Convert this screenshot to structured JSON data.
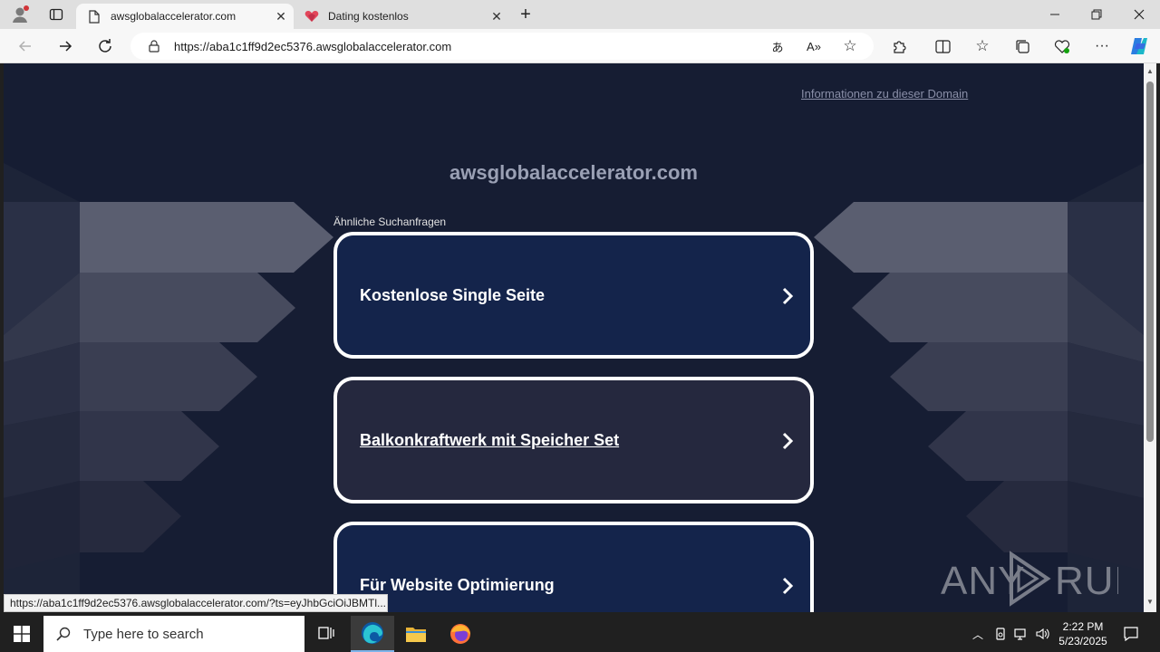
{
  "browser": {
    "tabs": [
      {
        "title": "awsglobalaccelerator.com",
        "active": true
      },
      {
        "title": "Dating kostenlos",
        "active": false
      }
    ],
    "address": "https://aba1c1ff9d2ec5376.awsglobalaccelerator.com",
    "status_url": "https://aba1c1ff9d2ec5376.awsglobalaccelerator.com/?ts=eyJhbGciOiJBMTl..."
  },
  "page": {
    "domain_info_link": "Informationen zu dieser Domain",
    "site_title": "awsglobalaccelerator.com",
    "related_label": "Ähnliche Suchanfragen",
    "results": [
      {
        "label": "Kostenlose Single Seite"
      },
      {
        "label": "Balkonkraftwerk mit Speicher Set"
      },
      {
        "label": "Für Website Optimierung"
      }
    ],
    "watermark": "ANY RUN"
  },
  "taskbar": {
    "search_placeholder": "Type here to search",
    "time": "2:22 PM",
    "date": "5/23/2025"
  },
  "colors": {
    "page_bg": "#161d33",
    "card_bg": "#14244b",
    "card_hover_bg": "#25283e",
    "accent": "#0078d4"
  }
}
